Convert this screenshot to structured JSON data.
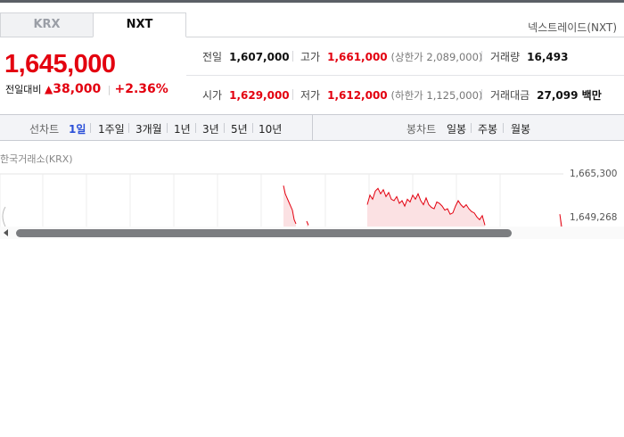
{
  "tabs": [
    {
      "label": "KRX",
      "active": false
    },
    {
      "label": "NXT",
      "active": true
    }
  ],
  "exchange_label": "넥스트레이드(NXT)",
  "quote": {
    "price": "1,645,000",
    "change_label": "전일대비",
    "change_amount": "38,000",
    "change_pct": "+2.36%",
    "direction_icon": "up-triangle-icon"
  },
  "stats": {
    "prev_close": {
      "label": "전일",
      "value": "1,607,000"
    },
    "high": {
      "label": "고가",
      "value": "1,661,000",
      "sub": "(상한가 2,089,000)"
    },
    "volume": {
      "label": "거래량",
      "value": "16,493"
    },
    "open": {
      "label": "시가",
      "value": "1,629,000"
    },
    "low": {
      "label": "저가",
      "value": "1,612,000",
      "sub": "(하한가 1,125,000)"
    },
    "amount": {
      "label": "거래대금",
      "value": "27,099 백만"
    }
  },
  "chart_controls": {
    "line_label": "선차트",
    "periods": [
      "1일",
      "1주일",
      "3개월",
      "1년",
      "3년",
      "5년",
      "10년"
    ],
    "active_period": "1일",
    "candle_label": "봉차트",
    "candle_periods": [
      "일봉",
      "주봉",
      "월봉"
    ]
  },
  "chart_title": "한국거래소(KRX)",
  "colors": {
    "up": "#e3000f",
    "active": "#2a4fd8",
    "fill": "#fbe1e3"
  },
  "chart_data": {
    "type": "area",
    "y_ticks": [
      "1,665,300",
      "1,649,268"
    ],
    "ylim": [
      1635000,
      1665300
    ],
    "grid": true,
    "segments": [
      {
        "x": [
          318,
          320,
          322,
          324,
          326,
          328,
          330,
          332
        ],
        "y": [
          1661000,
          1658000,
          1656500,
          1655000,
          1653500,
          1652000,
          1648500,
          1647000
        ]
      },
      {
        "x": [
          344,
          346
        ],
        "y": [
          1648000,
          1646500
        ]
      },
      {
        "x": [
          412,
          415,
          418,
          421,
          424,
          427,
          430,
          433,
          436,
          439,
          442,
          445,
          448,
          451,
          454,
          457,
          460,
          463,
          466,
          469,
          472,
          475,
          478,
          481,
          484,
          487,
          490,
          493,
          496,
          499,
          502,
          505,
          508,
          511,
          514,
          517,
          520,
          523,
          526,
          529,
          532,
          535,
          538,
          541,
          544
        ],
        "y": [
          1654000,
          1657500,
          1656000,
          1659000,
          1660000,
          1658000,
          1659500,
          1657000,
          1658500,
          1656000,
          1655500,
          1657000,
          1654500,
          1655500,
          1653500,
          1656000,
          1655000,
          1657500,
          1656000,
          1658000,
          1655500,
          1654000,
          1656500,
          1654000,
          1653000,
          1652500,
          1655000,
          1654500,
          1653500,
          1652000,
          1652500,
          1650500,
          1651000,
          1653500,
          1655500,
          1654000,
          1653000,
          1654000,
          1652500,
          1651500,
          1651000,
          1649500,
          1648500,
          1650000,
          1646500
        ]
      },
      {
        "x": [
          628,
          630
        ],
        "y": [
          1650500,
          1646000
        ]
      }
    ]
  }
}
